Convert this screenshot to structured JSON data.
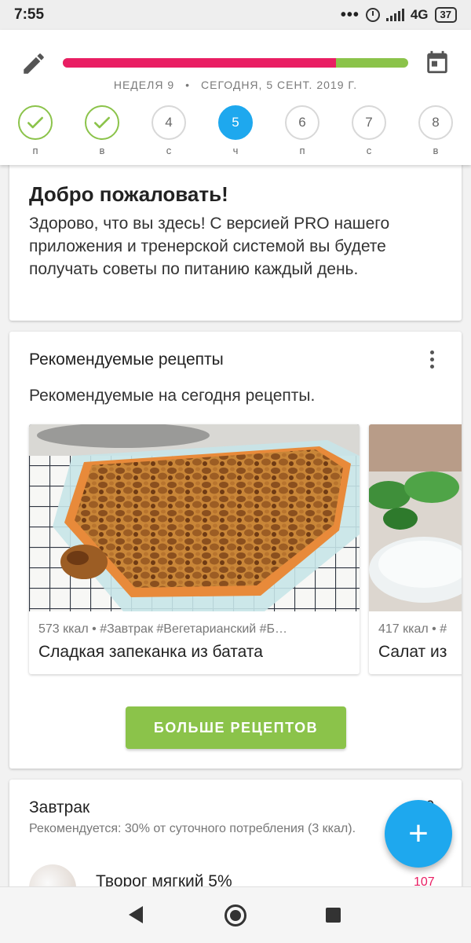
{
  "status_bar": {
    "time": "7:55",
    "network": "4G",
    "battery": "37"
  },
  "header": {
    "week_label": "НЕДЕЛЯ 9",
    "date_label": "СЕГОДНЯ, 5 СЕНТ. 2019 Г.",
    "progress": {
      "consumed_fraction": 0.79,
      "consumed_color": "#e91e63",
      "remaining_color": "#8bc34a"
    },
    "days": [
      {
        "number": "",
        "label": "п",
        "state": "done"
      },
      {
        "number": "",
        "label": "в",
        "state": "done"
      },
      {
        "number": "4",
        "label": "с",
        "state": "upcoming"
      },
      {
        "number": "5",
        "label": "ч",
        "state": "current"
      },
      {
        "number": "6",
        "label": "п",
        "state": "upcoming"
      },
      {
        "number": "7",
        "label": "с",
        "state": "upcoming"
      },
      {
        "number": "8",
        "label": "в",
        "state": "upcoming"
      }
    ],
    "icons": {
      "left": "edit-icon",
      "right": "calendar-icon"
    }
  },
  "welcome": {
    "title": "Добро пожаловать!",
    "text": "Здорово, что вы здесь! С версией PRO нашего приложения и тренерской системой вы будете получать советы по питанию каждый день."
  },
  "recipes": {
    "title": "Рекомендуемые рецепты",
    "subtitle": "Рекомендуемые на сегодня рецепты.",
    "items": [
      {
        "meta": "573 ккал • #Завтрак #Вегетарианский #Б…",
        "name": "Сладкая запеканка из батата"
      },
      {
        "meta": "417 ккал • #",
        "name": "Салат из"
      }
    ],
    "more_button": "БОЛЬШЕ РЕЦЕПТОВ"
  },
  "breakfast": {
    "title": "Завтрак",
    "calories": "30",
    "recommendation": "Рекомендуется: 30% от суточного потребления (3 ккал).",
    "food_name": "Творог мягкий 5%",
    "food_kcal": "107"
  },
  "colors": {
    "accent_blue": "#1ea8ee",
    "accent_green": "#8bc34a",
    "accent_pink": "#e91e63"
  }
}
